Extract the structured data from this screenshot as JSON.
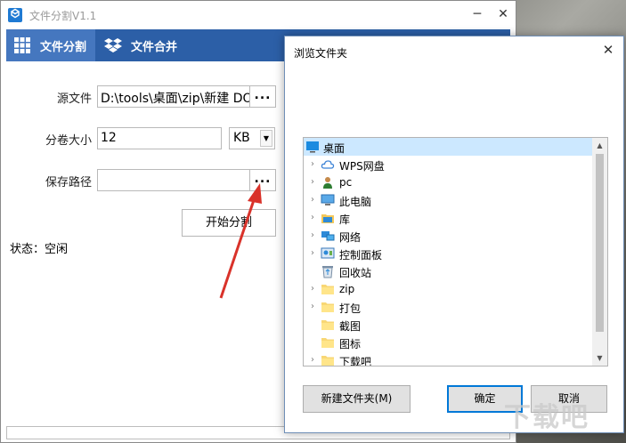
{
  "main_window": {
    "title": "文件分割V1.1",
    "minimize": "─",
    "close": "✕",
    "tabs": [
      {
        "label": "文件分割",
        "icon": "grid-icon",
        "active": true
      },
      {
        "label": "文件合并",
        "icon": "dropbox-icon",
        "active": false
      }
    ],
    "source_label": "源文件",
    "source_value": "D:\\tools\\桌面\\zip\\新建 DO",
    "browse_dots": "...",
    "volume_label": "分卷大小",
    "volume_value": "12",
    "unit_value": "KB",
    "save_label": "保存路径",
    "save_value": "",
    "start_button": "开始分割",
    "status": "状态：空闲",
    "progress": 0
  },
  "dialog": {
    "title": "浏览文件夹",
    "close": "✕",
    "tree": [
      {
        "label": "桌面",
        "icon": "desktop-icon",
        "expandable": false,
        "selected": true,
        "level": 0
      },
      {
        "label": "WPS网盘",
        "icon": "cloud-icon",
        "expandable": true,
        "selected": false,
        "level": 1
      },
      {
        "label": "pc",
        "icon": "user-icon",
        "expandable": true,
        "selected": false,
        "level": 1
      },
      {
        "label": "此电脑",
        "icon": "computer-icon",
        "expandable": true,
        "selected": false,
        "level": 1
      },
      {
        "label": "库",
        "icon": "library-icon",
        "expandable": true,
        "selected": false,
        "level": 1
      },
      {
        "label": "网络",
        "icon": "network-icon",
        "expandable": true,
        "selected": false,
        "level": 1
      },
      {
        "label": "控制面板",
        "icon": "control-panel-icon",
        "expandable": true,
        "selected": false,
        "level": 1
      },
      {
        "label": "回收站",
        "icon": "recycle-bin-icon",
        "expandable": false,
        "selected": false,
        "level": 1
      },
      {
        "label": "zip",
        "icon": "folder-icon",
        "expandable": true,
        "selected": false,
        "level": 1
      },
      {
        "label": "打包",
        "icon": "folder-icon",
        "expandable": true,
        "selected": false,
        "level": 1
      },
      {
        "label": "截图",
        "icon": "folder-icon",
        "expandable": false,
        "selected": false,
        "level": 1
      },
      {
        "label": "图标",
        "icon": "folder-icon",
        "expandable": false,
        "selected": false,
        "level": 1
      },
      {
        "label": "下载吧",
        "icon": "folder-icon",
        "expandable": true,
        "selected": false,
        "level": 1
      }
    ],
    "new_folder_button": "新建文件夹(M)",
    "ok_button": "确定",
    "cancel_button": "取消"
  },
  "colors": {
    "tabbar": "#2c5fa7",
    "tab_active": "#4577bf",
    "selection": "#cce8ff",
    "default_button_border": "#0078d7",
    "annotation_arrow": "#d9322a"
  }
}
